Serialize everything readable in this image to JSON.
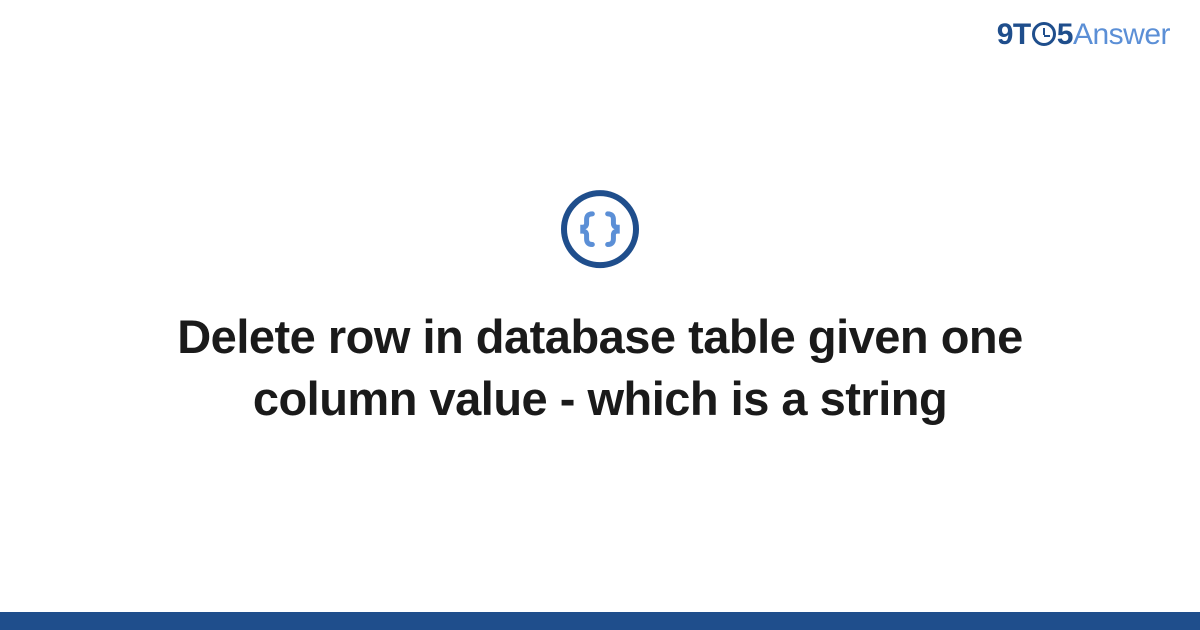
{
  "logo": {
    "part1": "9T",
    "part2": "5",
    "part3": "Answer"
  },
  "icon": {
    "name": "code-braces-icon",
    "color_outer": "#1f4e8c",
    "color_inner": "#5b8fd6"
  },
  "title": "Delete row in database table given one column value - which is a string",
  "colors": {
    "brand_dark": "#1f4e8c",
    "brand_light": "#5b8fd6",
    "footer": "#1f4e8c"
  }
}
